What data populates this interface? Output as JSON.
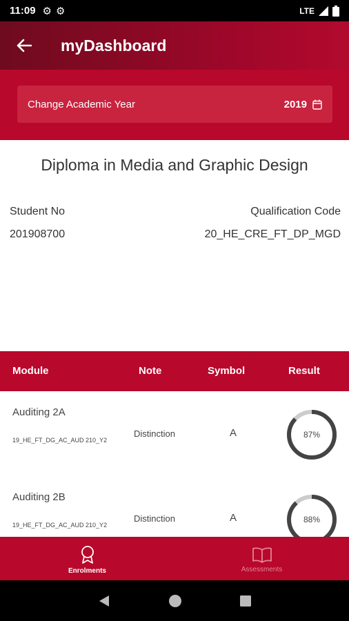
{
  "status_bar": {
    "time": "11:09",
    "network": "LTE"
  },
  "app_bar": {
    "title": "myDashboard"
  },
  "year_selector": {
    "label": "Change Academic Year",
    "year": "2019"
  },
  "qualification": {
    "title": "Diploma in Media and Graphic Design",
    "student_no_label": "Student No",
    "student_no": "201908700",
    "code_label": "Qualification Code",
    "code": "20_HE_CRE_FT_DP_MGD"
  },
  "table": {
    "headers": {
      "module": "Module",
      "note": "Note",
      "symbol": "Symbol",
      "result": "Result"
    },
    "rows": [
      {
        "module": "Auditing 2A",
        "code": "19_HE_FT_DG_AC_AUD 210_Y2",
        "note": "Distinction",
        "symbol": "A",
        "result": "87%",
        "result_value": 0.87
      },
      {
        "module": "Auditing 2B",
        "code": "19_HE_FT_DG_AC_AUD 210_Y2",
        "note": "Distinction",
        "symbol": "A",
        "result": "88%",
        "result_value": 0.88
      }
    ]
  },
  "bottom_nav": {
    "items": [
      {
        "label": "Enrolments",
        "icon": "award-icon",
        "active": true
      },
      {
        "label": "Assessments",
        "icon": "book-icon",
        "active": false
      }
    ]
  },
  "colors": {
    "primary": "#b8082b",
    "appbar_dark": "#6e0b1e",
    "ring": "#444444",
    "ring_track": "#cccccc"
  }
}
